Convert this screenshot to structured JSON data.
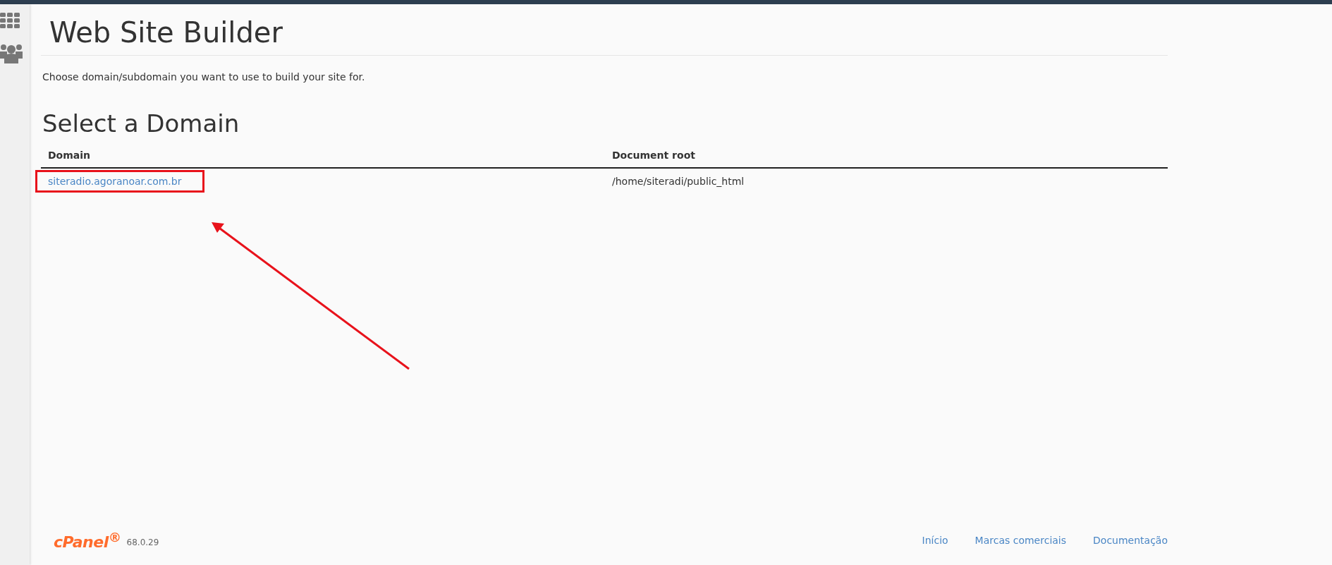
{
  "page": {
    "title": "Web Site Builder",
    "description": "Choose domain/subdomain you want to use to build your site for."
  },
  "section": {
    "title": "Select a Domain"
  },
  "table": {
    "columns": [
      "Domain",
      "Document root"
    ],
    "rows": [
      {
        "domain": "siteradio.agoranoar.com.br",
        "document_root": "/home/siteradi/public_html",
        "highlighted": true
      }
    ]
  },
  "footer": {
    "logo": "cPanel$^{®}$",
    "version": "68.0.29",
    "links": [
      "Início",
      "Marcas comerciais",
      "Documentação"
    ]
  }
}
